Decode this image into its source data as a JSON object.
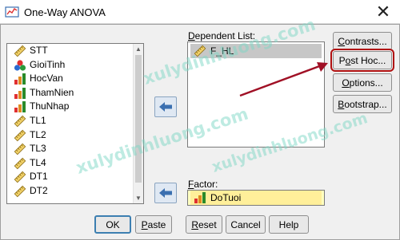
{
  "window": {
    "title": "One-Way ANOVA",
    "close_glyph": "✕"
  },
  "variables": [
    {
      "name": "STT",
      "icon": "scale-ruler-icon"
    },
    {
      "name": "GioiTinh",
      "icon": "nominal-balls-icon"
    },
    {
      "name": "HocVan",
      "icon": "ordinal-bars-icon"
    },
    {
      "name": "ThamNien",
      "icon": "ordinal-bars-icon"
    },
    {
      "name": "ThuNhap",
      "icon": "ordinal-bars-icon"
    },
    {
      "name": "TL1",
      "icon": "scale-ruler-icon"
    },
    {
      "name": "TL2",
      "icon": "scale-ruler-icon"
    },
    {
      "name": "TL3",
      "icon": "scale-ruler-icon"
    },
    {
      "name": "TL4",
      "icon": "scale-ruler-icon"
    },
    {
      "name": "DT1",
      "icon": "scale-ruler-icon"
    },
    {
      "name": "DT2",
      "icon": "scale-ruler-icon"
    }
  ],
  "dependent": {
    "label_prefix": "",
    "label_key": "D",
    "label_rest": "ependent List:",
    "items": [
      {
        "name": "F_HL",
        "icon": "scale-ruler-icon"
      }
    ]
  },
  "factor": {
    "label_key": "F",
    "label_rest": "actor:",
    "value": "DoTuoi",
    "icon": "ordinal-bars-icon"
  },
  "side_buttons": {
    "contrasts": {
      "key": "C",
      "rest": "ontrasts..."
    },
    "post_hoc": {
      "pre": "P",
      "key": "o",
      "rest": "st Hoc..."
    },
    "options": {
      "key": "O",
      "rest": "ptions..."
    },
    "bootstrap": {
      "key": "B",
      "rest": "ootstrap..."
    }
  },
  "bottom_buttons": {
    "ok": "OK",
    "paste": {
      "key": "P",
      "rest": "aste"
    },
    "reset": {
      "key": "R",
      "rest": "eset"
    },
    "cancel": "Cancel",
    "help": "Help"
  },
  "watermarks": [
    "xulydinhluong.com",
    "xulydinhluong.com",
    "xulydinhluong.com"
  ],
  "colors": {
    "highlight": "#b01010",
    "factor_bg": "#ffffc0",
    "accent_arrow": "#3a6fb0"
  }
}
